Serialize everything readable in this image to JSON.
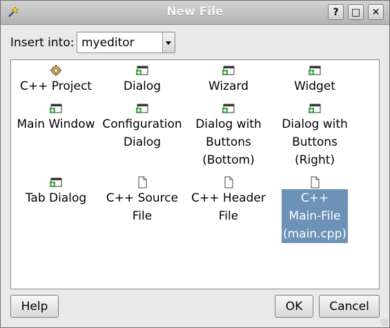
{
  "window": {
    "title": "New File",
    "help_glyph": "?",
    "max_glyph": "□",
    "close_glyph": "✕"
  },
  "insert": {
    "label": "Insert into:",
    "selected_value": "myeditor"
  },
  "templates": [
    {
      "label": "C++ Project",
      "icon": "gear-icon",
      "selected": false
    },
    {
      "label": "Dialog",
      "icon": "window-add-icon",
      "selected": false
    },
    {
      "label": "Wizard",
      "icon": "window-add-icon",
      "selected": false
    },
    {
      "label": "Widget",
      "icon": "window-add-icon",
      "selected": false
    },
    {
      "label": "Main Window",
      "icon": "window-add-icon",
      "selected": false
    },
    {
      "label": "Configuration\nDialog",
      "icon": "window-add-icon",
      "selected": false
    },
    {
      "label": "Dialog with\nButtons\n(Bottom)",
      "icon": "window-add-icon",
      "selected": false
    },
    {
      "label": "Dialog with\nButtons\n(Right)",
      "icon": "window-add-icon",
      "selected": false
    },
    {
      "label": "Tab Dialog",
      "icon": "window-add-icon",
      "selected": false
    },
    {
      "label": "C++ Source\nFile",
      "icon": "document-icon",
      "selected": false
    },
    {
      "label": "C++ Header\nFile",
      "icon": "document-icon",
      "selected": false
    },
    {
      "label": "C++\nMain-File\n(main.cpp)",
      "icon": "document-icon",
      "selected": true
    }
  ],
  "buttons": {
    "help": "Help",
    "ok": "OK",
    "cancel": "Cancel"
  },
  "colors": {
    "selection": "#6d92b7"
  }
}
